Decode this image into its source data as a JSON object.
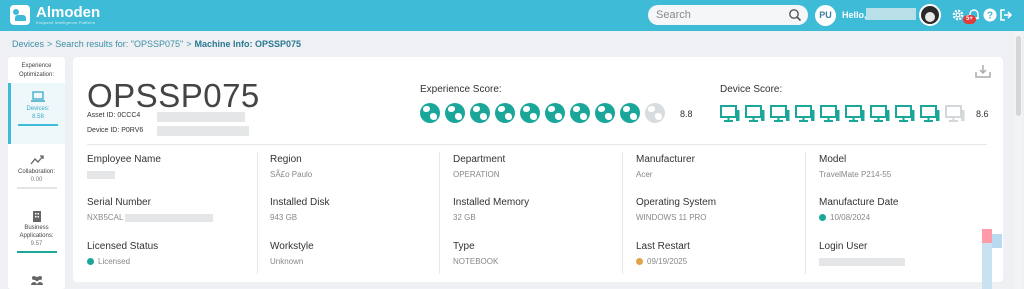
{
  "app": {
    "name": "Almoden",
    "tagline": "Endpoint Intelligence Platform"
  },
  "header": {
    "search_placeholder": "Search",
    "user_initials": "PU",
    "greeting": "Hello,",
    "notification_count": "5+"
  },
  "breadcrumb": {
    "items": [
      "Devices",
      "Search results for: \"OPSSP075\""
    ],
    "current": "Machine Info: OPSSP075"
  },
  "sidebar": {
    "heading": "Experience Optimization:",
    "items": [
      {
        "label": "Devices:",
        "value": "8.58",
        "icon": "laptop-icon",
        "active": true
      },
      {
        "label": "Collaboration:",
        "value": "0.00",
        "icon": "trend-icon",
        "active": false
      },
      {
        "label": "Business Applications:",
        "value": "9.57",
        "icon": "building-icon",
        "active": false
      },
      {
        "label": "",
        "value": "",
        "icon": "users-icon",
        "active": false
      }
    ]
  },
  "machine": {
    "name": "OPSSP075",
    "asset_label": "Asset ID: 0CCC4",
    "device_label": "Device ID: P0RV6"
  },
  "experience_score": {
    "label": "Experience Score:",
    "value": "8.8",
    "filled": 9,
    "total": 10,
    "icon": "globe-icon"
  },
  "device_score": {
    "label": "Device Score:",
    "value": "8.6",
    "filled": 9,
    "total": 10,
    "icon": "monitor-icon"
  },
  "colors": {
    "accent": "#3ebbd6",
    "score": "#1aa79a",
    "licensed": "#1aa79a",
    "warn": "#e0a34a"
  },
  "fields": [
    {
      "label": "Employee Name",
      "value": ""
    },
    {
      "label": "Region",
      "value": "SÃ£o Paulo"
    },
    {
      "label": "Department",
      "value": "OPERATION"
    },
    {
      "label": "Manufacturer",
      "value": "Acer"
    },
    {
      "label": "Model",
      "value": "TravelMate P214-55"
    },
    {
      "label": "Serial Number",
      "value": "NXB5CAL"
    },
    {
      "label": "Installed Disk",
      "value": "943 GB"
    },
    {
      "label": "Installed Memory",
      "value": "32 GB"
    },
    {
      "label": "Operating System",
      "value": "WINDOWS 11 PRO"
    },
    {
      "label": "Manufacture Date",
      "value": "10/08/2024",
      "status": "ok"
    },
    {
      "label": "Licensed Status",
      "value": "Licensed",
      "status": "ok"
    },
    {
      "label": "Workstyle",
      "value": "Unknown"
    },
    {
      "label": "Type",
      "value": "NOTEBOOK"
    },
    {
      "label": "Last Restart",
      "value": "09/19/2025",
      "status": "warn"
    },
    {
      "label": "Login User",
      "value": ""
    }
  ]
}
